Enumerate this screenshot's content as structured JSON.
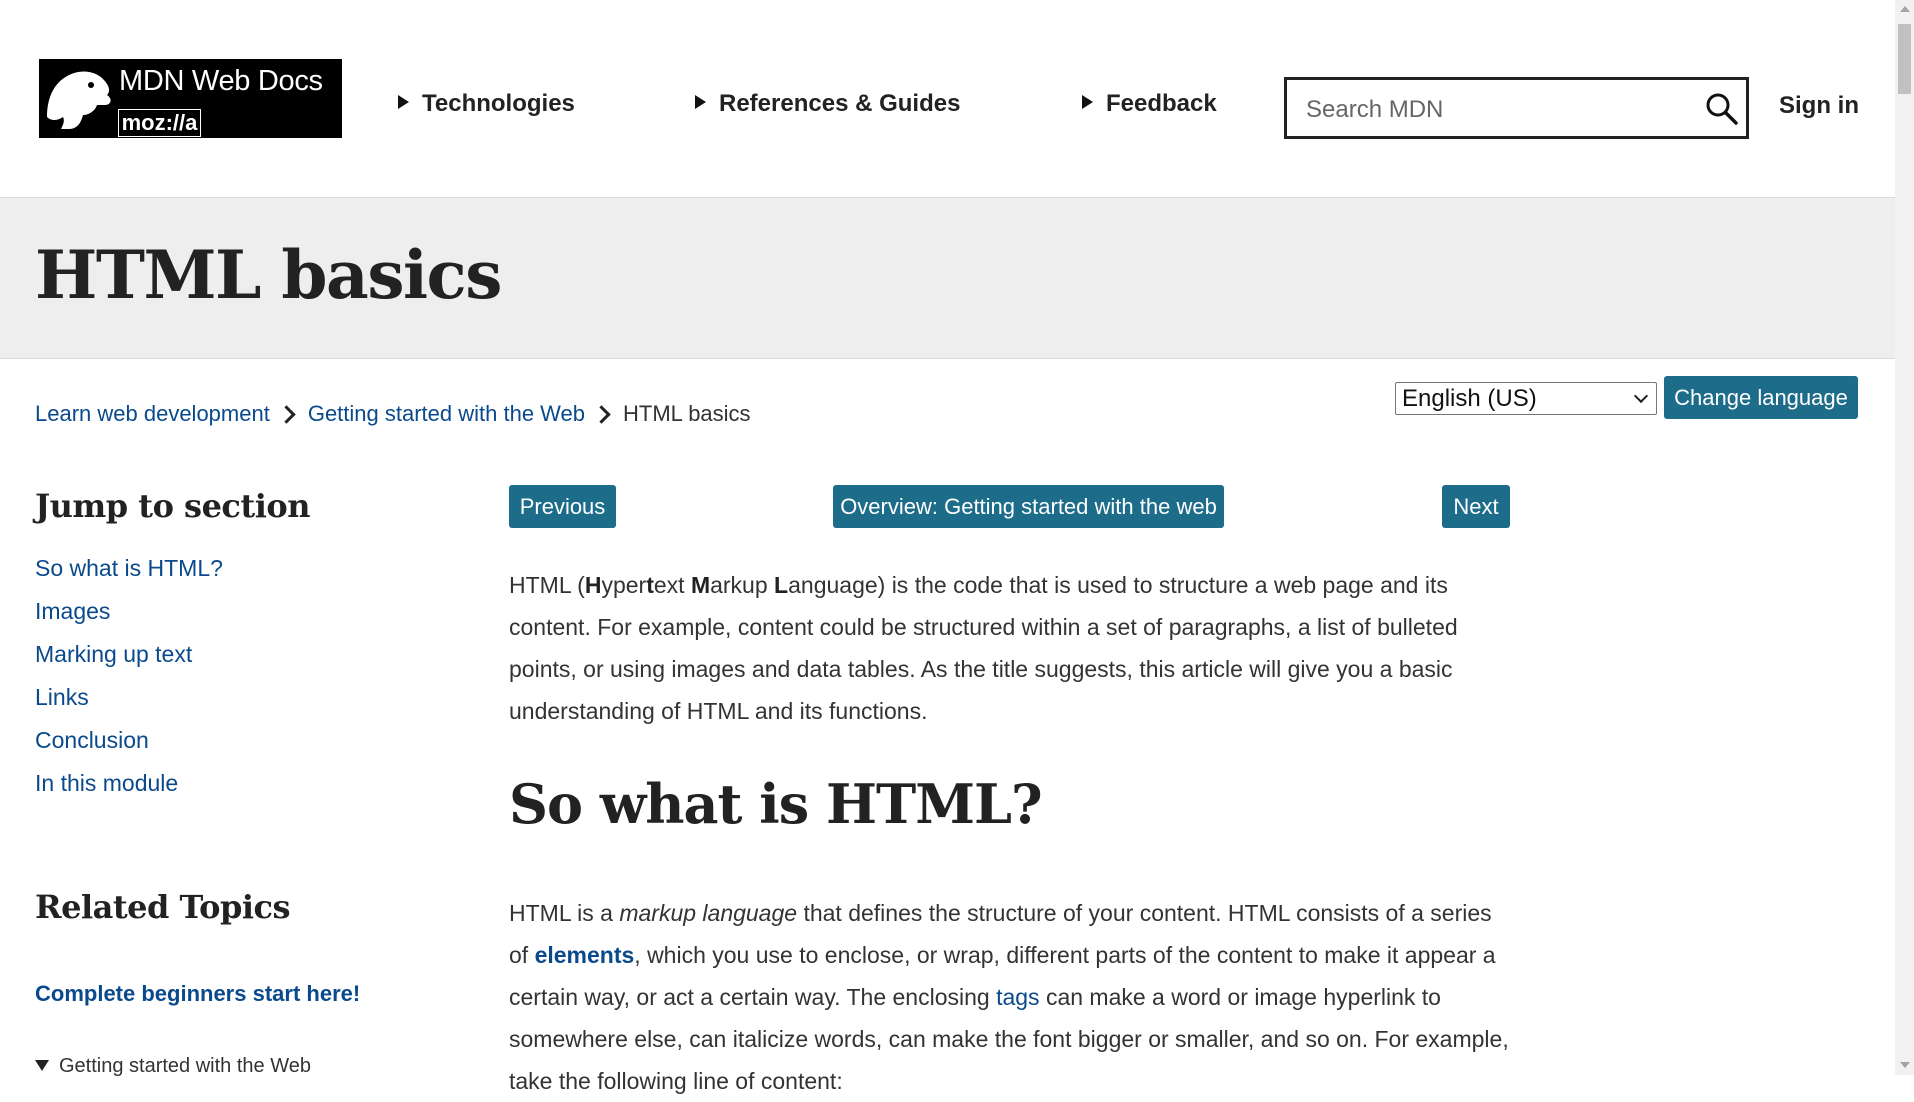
{
  "header": {
    "logo": {
      "title": "MDN Web Docs",
      "moz": "moz://a"
    },
    "nav": [
      "Technologies",
      "References & Guides",
      "Feedback"
    ],
    "search_placeholder": "Search MDN",
    "signin": "Sign in"
  },
  "page": {
    "title": "HTML basics"
  },
  "breadcrumb": {
    "items": [
      "Learn web development",
      "Getting started with the Web"
    ],
    "current": "HTML basics"
  },
  "language": {
    "selected": "English (US)",
    "button": "Change language"
  },
  "sidebar": {
    "jump_heading": "Jump to section",
    "toc": [
      "So what is HTML?",
      "Images",
      "Marking up text",
      "Links",
      "Conclusion",
      "In this module"
    ],
    "related_heading": "Related Topics",
    "related_link": "Complete beginners start here!",
    "related_sub": "Getting started with the Web"
  },
  "main": {
    "prev": "Previous",
    "overview": "Overview: Getting started with the web",
    "next": "Next",
    "intro": {
      "t1": "HTML (",
      "h": "H",
      "t2": "yper",
      "t": "t",
      "t3": "ext ",
      "m": "M",
      "t4": "arkup ",
      "l": "L",
      "t5": "anguage) is the code that is used to structure a web page and its content. For example, content could be structured within a set of paragraphs, a list of bulleted points, or using images and data tables. As the title suggests, this article will give you a basic understanding of HTML and its functions."
    },
    "section_heading": "So what is HTML?",
    "body": {
      "t1": "HTML is a ",
      "em": "markup language",
      "t2": " that defines the structure of your content. HTML consists of a series of ",
      "elements": "elements",
      "t3": ", which you use to enclose, or wrap, different parts of the content to make it appear a certain way, or act a certain way. The enclosing ",
      "tags": "tags",
      "t4": " can make a word or image hyperlink to somewhere else, can italicize words, can make the font bigger or smaller, and so on. For example, take the following line of content:"
    }
  },
  "colors": {
    "button": "#1d6c8a",
    "link": "#0a4a8c",
    "band": "#eeeeee"
  }
}
